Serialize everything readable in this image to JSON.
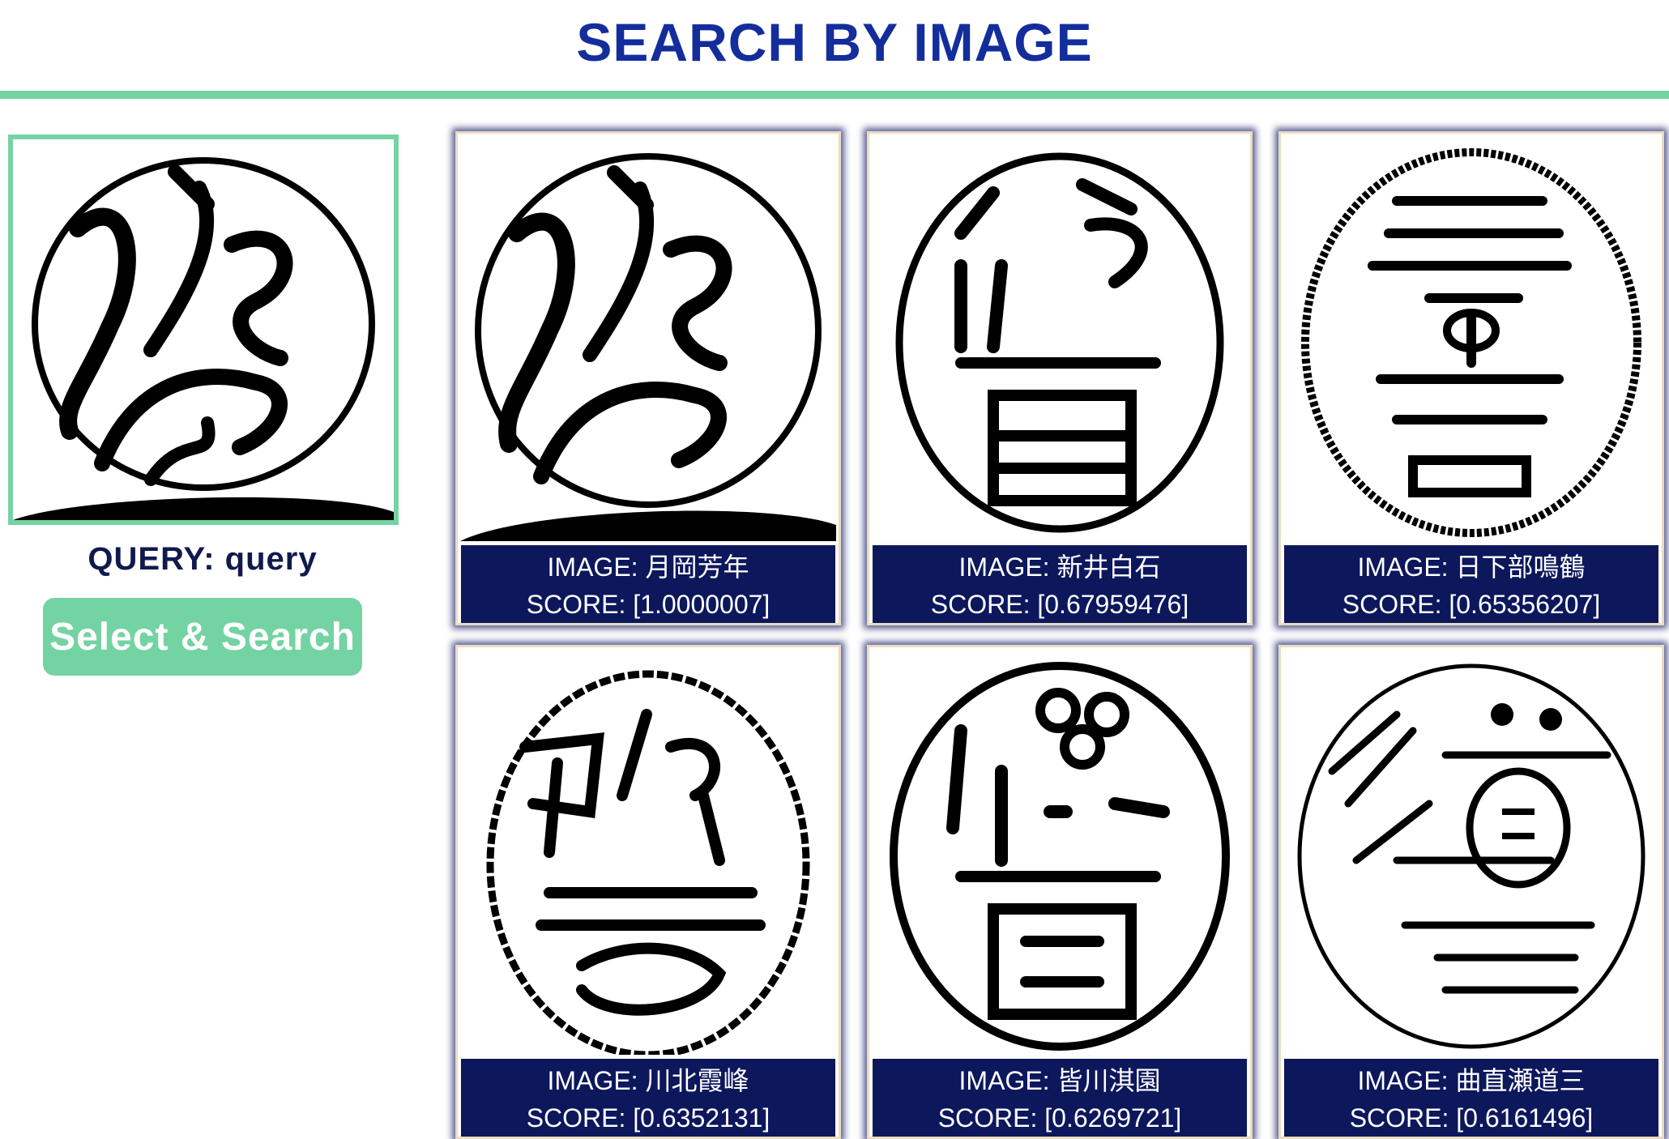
{
  "header": {
    "title": "SEARCH BY IMAGE"
  },
  "query": {
    "label": "QUERY: query",
    "button_label": "Select & Search"
  },
  "results": [
    {
      "image_label": "IMAGE: 月岡芳年",
      "score_label": "SCORE: [1.0000007]"
    },
    {
      "image_label": "IMAGE: 新井白石",
      "score_label": "SCORE: [0.67959476]"
    },
    {
      "image_label": "IMAGE: 日下部鳴鶴",
      "score_label": "SCORE: [0.65356207]"
    },
    {
      "image_label": "IMAGE: 川北霞峰",
      "score_label": "SCORE: [0.6352131]"
    },
    {
      "image_label": "IMAGE: 皆川淇園",
      "score_label": "SCORE: [0.6269721]"
    },
    {
      "image_label": "IMAGE: 曲直瀬道三",
      "score_label": "SCORE: [0.6161496]"
    }
  ],
  "colors": {
    "accent": "#74d3a3",
    "title": "#142d9c",
    "caption_bg": "#0c175c"
  }
}
